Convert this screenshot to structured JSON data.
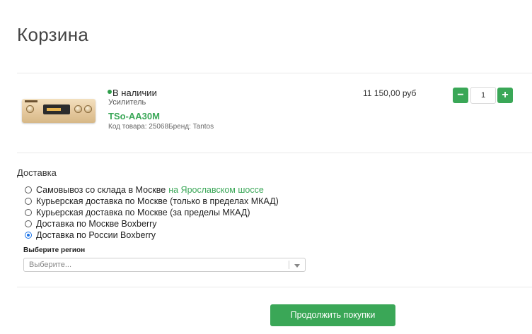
{
  "page_title": "Корзина",
  "cart": {
    "items": [
      {
        "stock_status": "В наличии",
        "category": "Усилитель",
        "name": "TSo-AA30M",
        "meta": "Код товара: 25068Бренд: Tantos",
        "price": "11 150,00 руб",
        "quantity": "1",
        "minus_label": "−",
        "plus_label": "+"
      }
    ]
  },
  "delivery": {
    "heading": "Доставка",
    "options": [
      {
        "label": "Самовывоз со склада в Москве",
        "link": "на Ярославском шоссе",
        "checked": false
      },
      {
        "label": "Курьерская доставка по Москве (только в пределах МКАД)",
        "checked": false
      },
      {
        "label": "Курьерская доставка по Москве (за пределы МКАД)",
        "checked": false
      },
      {
        "label": "Доставка по Москве Boxberry",
        "checked": false
      },
      {
        "label": "Доставка по России Boxberry",
        "checked": true
      }
    ],
    "region_label": "Выберите регион",
    "region_placeholder": "Выберите..."
  },
  "actions": {
    "continue_label": "Продолжить покупки"
  },
  "colors": {
    "accent_green": "#3aa757",
    "radio_selected": "#1a73e8"
  },
  "icons": [
    "chevron-down-icon",
    "minus-icon",
    "plus-icon"
  ]
}
